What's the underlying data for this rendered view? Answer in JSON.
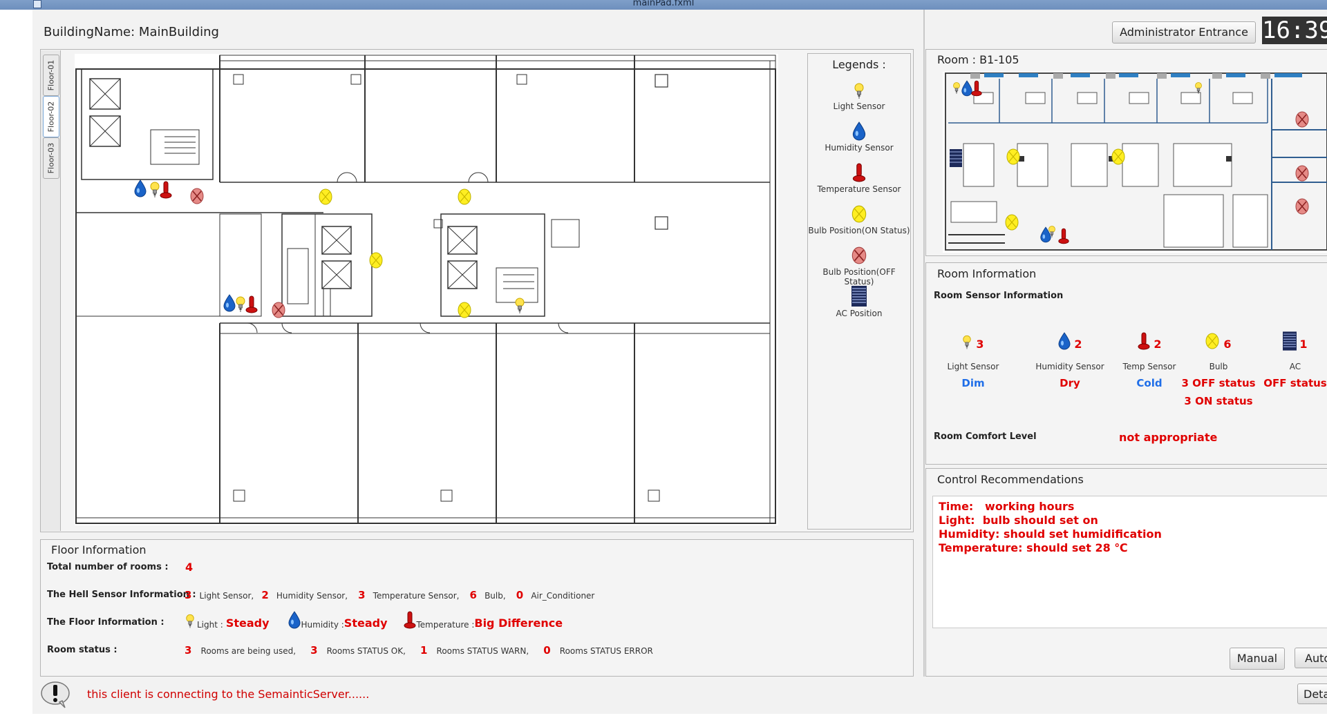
{
  "window": {
    "title": "mainPad.fxml"
  },
  "header": {
    "building_label": "BuildingName: MainBuilding"
  },
  "floor_tabs": [
    "Floor-01",
    "Floor-02",
    "Floor-03"
  ],
  "active_tab": "Floor-02",
  "legend": {
    "title": "Legends :",
    "items": [
      {
        "icon": "light-sensor-icon",
        "label": "Light Sensor"
      },
      {
        "icon": "humidity-sensor-icon",
        "label": "Humidity Sensor"
      },
      {
        "icon": "temperature-sensor-icon",
        "label": "Temperature Sensor"
      },
      {
        "icon": "bulb-on-icon",
        "label": "Bulb Position(ON Status)"
      },
      {
        "icon": "bulb-off-icon",
        "label": "Bulb Position(OFF Status)"
      },
      {
        "icon": "ac-icon",
        "label": "AC Position"
      }
    ]
  },
  "colors": {
    "bulb_on": "#ffee22",
    "bulb_off": "#d9534f",
    "humidity": "#1a63c8",
    "temperature": "#cc1111",
    "alert_text": "#e00000",
    "info_text": "#1f6ee8",
    "titlebar": "#7f9fc9"
  },
  "floor_info": {
    "title": "Floor Information",
    "total_rooms_label": "Total number of rooms :",
    "total_rooms_value": "4",
    "sensor_label": "The Hell Sensor Information :",
    "sensors": [
      {
        "count": "3",
        "label": "Light Sensor,"
      },
      {
        "count": "2",
        "label": "Humidity Sensor,"
      },
      {
        "count": "3",
        "label": "Temperature Sensor,"
      },
      {
        "count": "6",
        "label": "Bulb,"
      },
      {
        "count": "0",
        "label": "Air_Conditioner"
      }
    ],
    "floor_label": "The Floor Information :",
    "floor_status": [
      {
        "icon": "light-sensor-icon",
        "label": "Light :",
        "value": "Steady"
      },
      {
        "icon": "humidity-sensor-icon",
        "label": "Humidity :",
        "value": "Steady"
      },
      {
        "icon": "temperature-sensor-icon",
        "label": "Temperature :",
        "value": "Big Difference"
      }
    ],
    "room_status_label": "Room status :",
    "room_status": [
      {
        "count": "3",
        "label": "Rooms are being used,"
      },
      {
        "count": "3",
        "label": "Rooms STATUS OK,"
      },
      {
        "count": "1",
        "label": "Rooms STATUS WARN,"
      },
      {
        "count": "0",
        "label": "Rooms STATUS ERROR"
      }
    ]
  },
  "top_right": {
    "admin_button": "Administrator Entrance",
    "clock": "16:39"
  },
  "room": {
    "label": "Room : B1-105"
  },
  "room_info": {
    "title": "Room Information",
    "sensor_heading": "Room Sensor Information",
    "columns": [
      {
        "icon": "light-sensor-icon",
        "count": "3",
        "label": "Light Sensor",
        "status": [
          "Dim"
        ],
        "status_color": "blue"
      },
      {
        "icon": "humidity-sensor-icon",
        "count": "2",
        "label": "Humidity Sensor",
        "status": [
          "Dry"
        ],
        "status_color": "red"
      },
      {
        "icon": "temperature-sensor-icon",
        "count": "2",
        "label": "Temp Sensor",
        "status": [
          "Cold"
        ],
        "status_color": "blue"
      },
      {
        "icon": "bulb-on-icon",
        "count": "6",
        "label": "Bulb",
        "status": [
          "3 OFF status",
          "3 ON status"
        ],
        "status_color": "red"
      },
      {
        "icon": "ac-icon",
        "count": "1",
        "label": "AC",
        "status": [
          "OFF status"
        ],
        "status_color": "red"
      }
    ],
    "comfort_label": "Room Comfort Level",
    "comfort_value": "not appropriate"
  },
  "control": {
    "title": "Control Recommendations",
    "lines": [
      "Time:   working hours",
      "Light:  bulb should set on",
      "Humidity: should set humidification",
      "Temperature: should set 28 ℃"
    ],
    "manual_button": "Manual",
    "auto_button": "Auto"
  },
  "status_bar": {
    "message": "this client is connecting to the SemainticServer......",
    "details_button": "Details"
  }
}
